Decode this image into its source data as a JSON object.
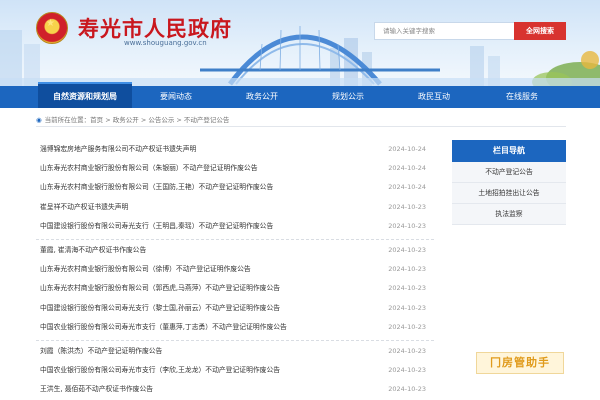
{
  "header": {
    "site_title": "寿光市人民政府",
    "site_url": "www.shouguang.gov.cn",
    "search_placeholder": "请输入关键字搜索",
    "search_button": "全网搜索"
  },
  "nav": {
    "items": [
      "自然资源和规划局",
      "要闻动态",
      "政务公开",
      "规划公示",
      "政民互动",
      "在线服务"
    ]
  },
  "breadcrumb": "当前所在位置：首页 > 政务公开 > 公告公示 > 不动产登记公告",
  "list": {
    "groups": [
      [
        {
          "title": "淄博锦宏房地产服务有限公司不动产权证书遗失声明",
          "date": "2024-10-24"
        },
        {
          "title": "山东寿光农村商业银行股份有限公司（朱银丽）不动产登记证明作废公告",
          "date": "2024-10-24"
        },
        {
          "title": "山东寿光农村商业银行股份有限公司（王国防,王艳）不动产登记证明作废公告",
          "date": "2024-10-24"
        },
        {
          "title": "崔呈祥不动产权证书遗失声明",
          "date": "2024-10-23"
        },
        {
          "title": "中国建设银行股份有限公司寿光支行（王明昌,秦瑶）不动产登记证明作废公告",
          "date": "2024-10-23"
        }
      ],
      [
        {
          "title": "董霞, 崔清海不动产权证书作废公告",
          "date": "2024-10-23"
        },
        {
          "title": "山东寿光农村商业银行股份有限公司（徐博）不动产登记证明作废公告",
          "date": "2024-10-23"
        },
        {
          "title": "山东寿光农村商业银行股份有限公司（郭西虎,马燕萍）不动产登记证明作废公告",
          "date": "2024-10-23"
        },
        {
          "title": "中国建设银行股份有限公司寿光支行（黎士国,孙丽云）不动产登记证明作废公告",
          "date": "2024-10-23"
        },
        {
          "title": "中国农业银行股份有限公司寿光市支行（董惠萍,丁志勇）不动产登记证明作废公告",
          "date": "2024-10-23"
        }
      ],
      [
        {
          "title": "刘霞（陈洪杰）不动产登记证明作废公告",
          "date": "2024-10-23"
        },
        {
          "title": "中国农业银行股份有限公司寿光市支行（李欣,王龙龙）不动产登记证明作废公告",
          "date": "2024-10-23"
        },
        {
          "title": "王洪生, 聂佰茹不动产权证书作废公告",
          "date": "2024-10-23"
        }
      ]
    ]
  },
  "sidebar": {
    "heading": "栏目导航",
    "items": [
      "不动产登记公告",
      "土地招拍挂出让公告",
      "执法监察"
    ]
  },
  "badge": "房管助手"
}
